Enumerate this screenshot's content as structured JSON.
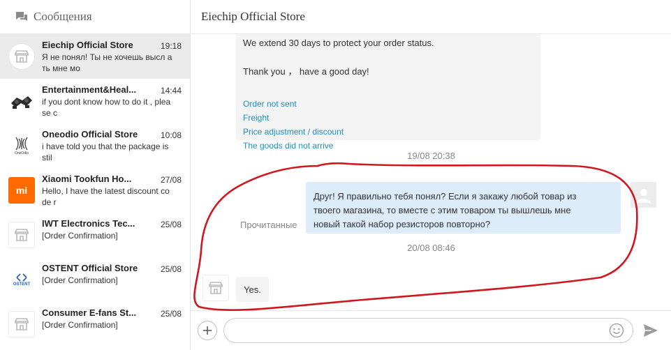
{
  "sidebar": {
    "title": "Сообщения",
    "conversations": [
      {
        "name": "Eiechip Official Store",
        "time": "19:18",
        "preview": "Я не понял! Ты не хочешь высл ать мне мо",
        "avatar": "store-icon"
      },
      {
        "name": "Entertainment&Heal...",
        "time": "14:44",
        "preview": "if you dont know how to do it , plea se c",
        "avatar": "gamepad-logo"
      },
      {
        "name": "Oneodio Official Store",
        "time": "10:08",
        "preview": "i have told you that the package is stil",
        "avatar": "oneodio-logo"
      },
      {
        "name": "Xiaomi Tookfun Ho...",
        "time": "27/08",
        "preview": "Hello, I have the latest discount co de r",
        "avatar": "xiaomi-logo"
      },
      {
        "name": "IWT Electronics Tec...",
        "time": "25/08",
        "preview": "[Order Confirmation]",
        "avatar": "store-icon"
      },
      {
        "name": "OSTENT Official Store",
        "time": "25/08",
        "preview": "[Order Confirmation]",
        "avatar": "ostent-logo"
      },
      {
        "name": "Consumer E-fans St...",
        "time": "25/08",
        "preview": "[Order Confirmation]",
        "avatar": "store-icon"
      }
    ]
  },
  "logos": {
    "mi": "mi",
    "oneodio": "OneOdio",
    "ostent": "OSTENT"
  },
  "main": {
    "title": "Eiechip Official Store",
    "card": {
      "line1": "We extend 30 days to protect your order status.",
      "line2": "Thank you ， have a good day!",
      "links": [
        "Order not sent",
        "Freight",
        "Price adjustment / discount",
        "The goods did not arrive"
      ]
    },
    "timestamp1": "19/08 20:38",
    "outgoing": {
      "lines": [
        "Друг! Я правильно тебя понял? Если я закажу любой товар из",
        "твоего магазина, то вместе с этим товаром ты вышлешь мне",
        "новый такой набор резисторов повторно?"
      ],
      "status": "Прочитанные"
    },
    "timestamp2": "20/08 08:46",
    "incoming": {
      "text": "Yes."
    }
  },
  "composer": {
    "value": "",
    "placeholder": ""
  },
  "colors": {
    "link": "#1a8fc8",
    "outgoing_bubble": "#ddecfb",
    "annotation": "#d0161e",
    "mi_orange": "#ff6a00"
  }
}
